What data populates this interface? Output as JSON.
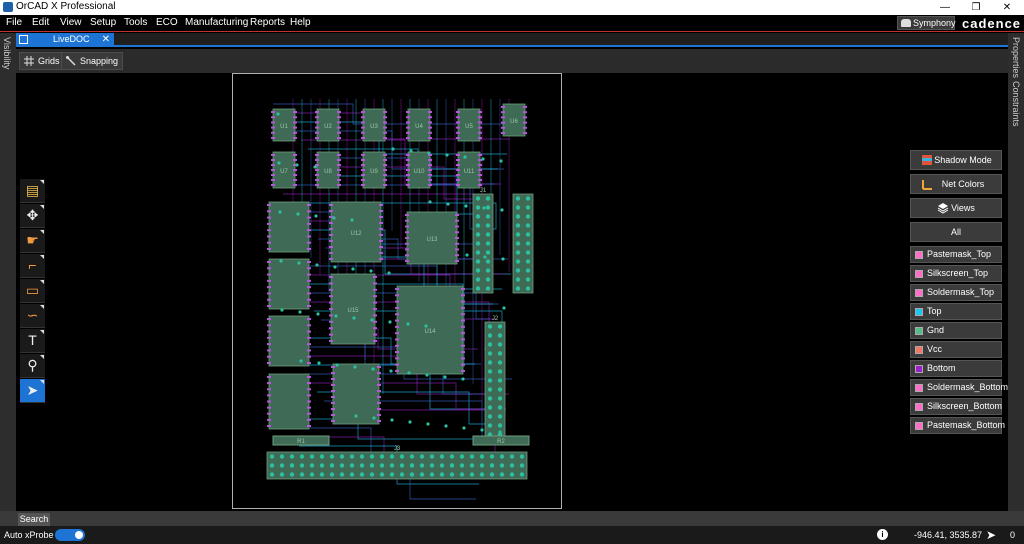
{
  "titlebar": {
    "title": "OrCAD X Professional",
    "minimize": "—",
    "restore": "❐",
    "close": "✕"
  },
  "menubar": {
    "items": [
      "File",
      "Edit",
      "View",
      "Setup",
      "Tools",
      "ECO",
      "Manufacturing",
      "Reports",
      "Help"
    ],
    "symphony": "Symphony",
    "brand": "cadence"
  },
  "left_rail": {
    "label": "Visibility"
  },
  "right_rail": {
    "labels": [
      "Properties",
      "Constraints"
    ]
  },
  "document_tab": {
    "label": "LiveDOC",
    "close": "✕"
  },
  "toolbar": {
    "grids": "Grids",
    "snapping": "Snapping"
  },
  "tool_palette": {
    "icons": [
      "comment-icon",
      "move-icon",
      "hand-icon",
      "route-icon",
      "shape-icon",
      "connect-icon",
      "text-icon",
      "zoom-icon",
      "select-cursor-icon"
    ],
    "active": "select-cursor-icon"
  },
  "visibility_panel": {
    "shadow_mode": "Shadow Mode",
    "net_colors": "Net Colors",
    "views": "Views",
    "all": "All",
    "layers": [
      {
        "name": "Pastemask_Top",
        "color": "#ff6fc8"
      },
      {
        "name": "Silkscreen_Top",
        "color": "#ff6fc8"
      },
      {
        "name": "Soldermask_Top",
        "color": "#ff6fc8"
      },
      {
        "name": "Top",
        "color": "#1fc4f0"
      },
      {
        "name": "Gnd",
        "color": "#55bb88"
      },
      {
        "name": "Vcc",
        "color": "#f07864"
      },
      {
        "name": "Bottom",
        "color": "#9e20c8"
      },
      {
        "name": "Soldermask_Bottom",
        "color": "#ff6fc8"
      },
      {
        "name": "Silkscreen_Bottom",
        "color": "#ff6fc8"
      },
      {
        "name": "Pastemask_Bottom",
        "color": "#ff6fc8"
      }
    ]
  },
  "search": {
    "label": "Search"
  },
  "statusbar": {
    "autoxprobe": "Auto xProbe",
    "coords": "-946.41, 3535.87",
    "selection_count": "0"
  },
  "pcb_labels": {
    "ic_small": [
      "U1",
      "U2",
      "U3",
      "U4",
      "U5",
      "U6",
      "U7",
      "U8",
      "U9",
      "U10",
      "U11"
    ],
    "ic_big": [
      "U12",
      "U13",
      "U14",
      "U15"
    ],
    "connectors": [
      "J1",
      "J2",
      "J3"
    ],
    "resistor_arrays": [
      "R1",
      "R2"
    ]
  }
}
